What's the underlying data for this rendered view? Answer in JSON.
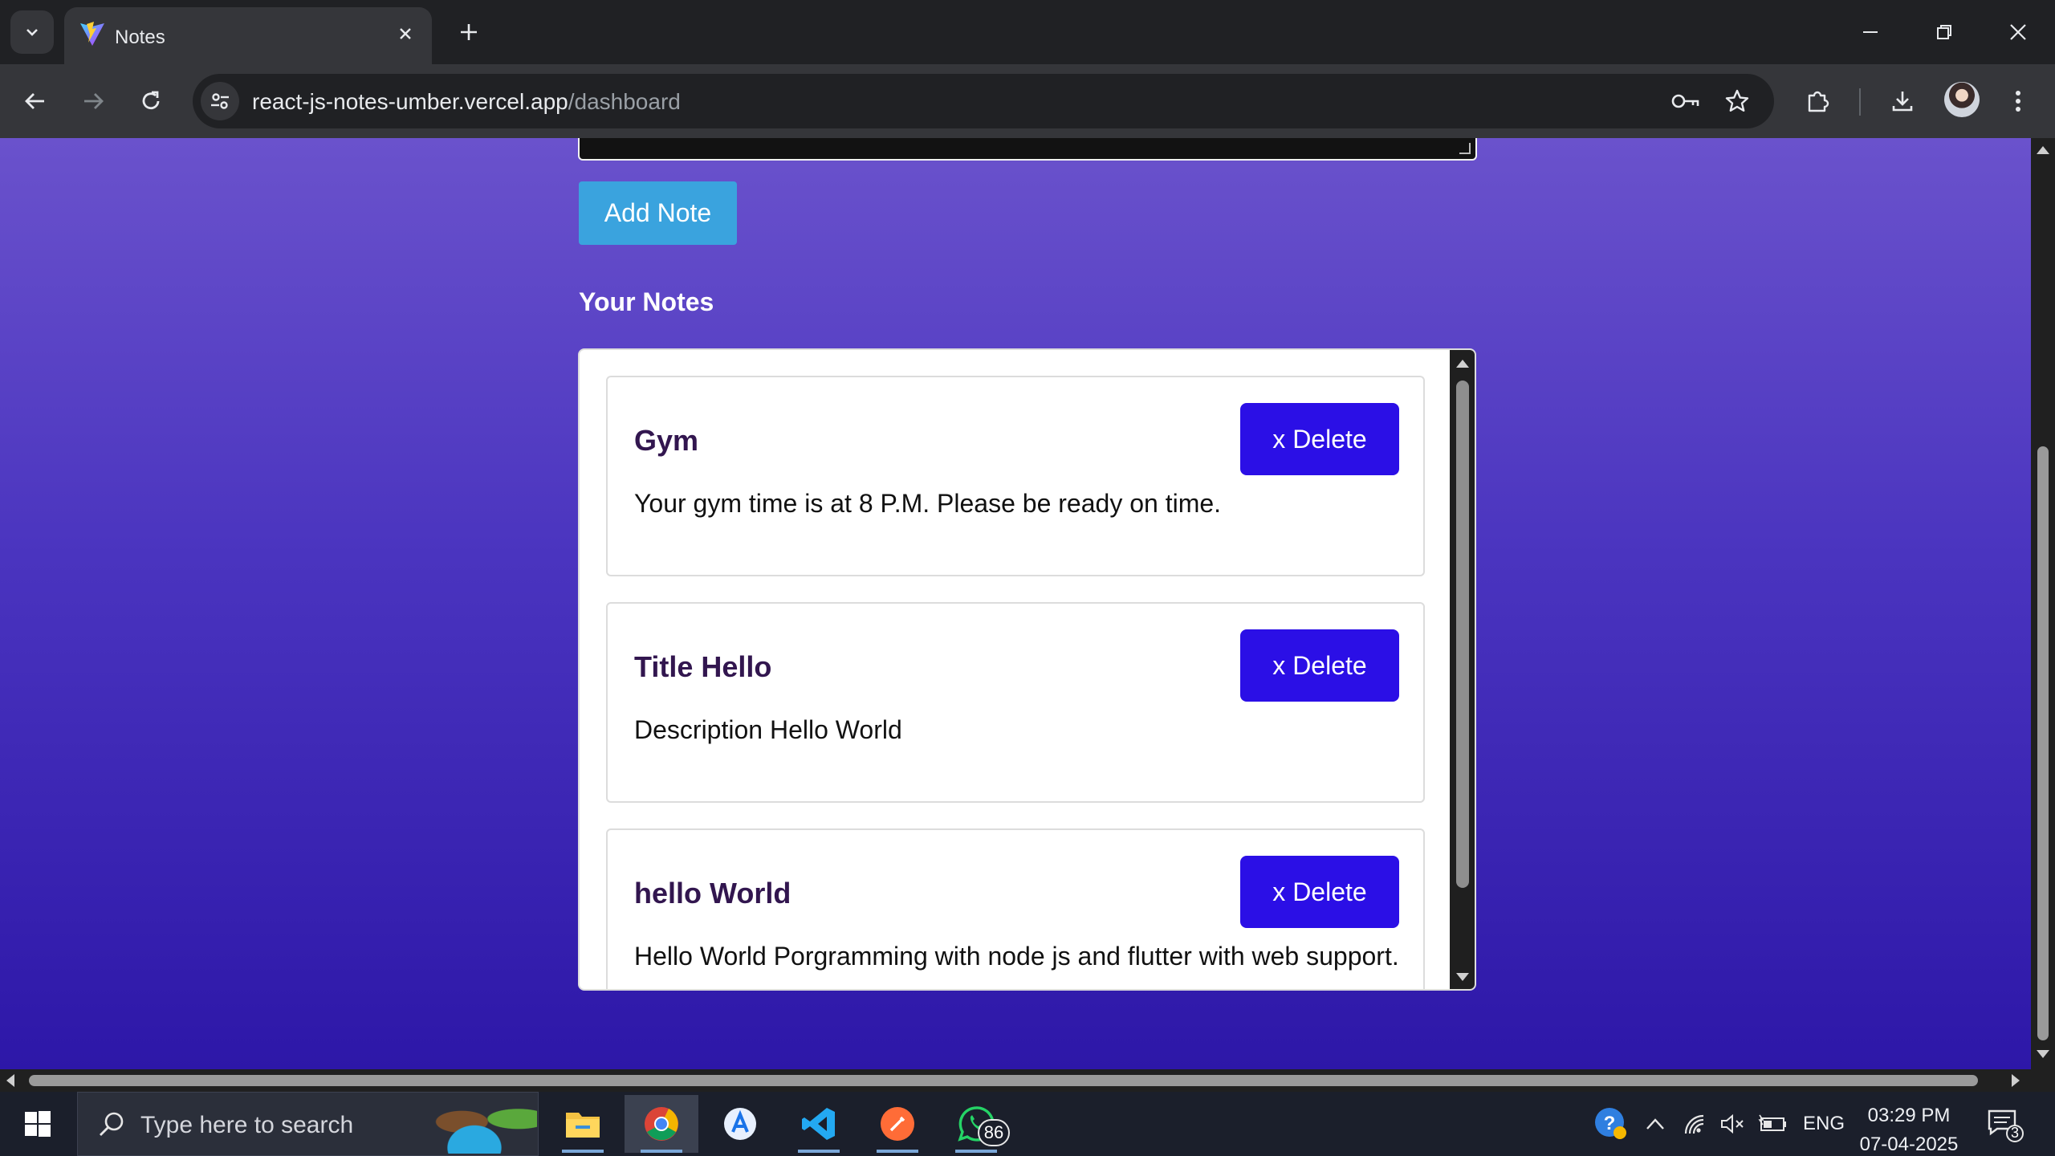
{
  "browser": {
    "tab_title": "Notes",
    "url_host": "react-js-notes-umber.vercel.app",
    "url_path": "/dashboard"
  },
  "page": {
    "add_button_label": "Add Note",
    "section_title": "Your Notes",
    "notes": [
      {
        "title": "Gym",
        "description": "Your gym time is at 8 P.M. Please be ready on time.",
        "delete_label": "x Delete"
      },
      {
        "title": "Title Hello",
        "description": "Description Hello World",
        "delete_label": "x Delete"
      },
      {
        "title": "hello World",
        "description": "Hello World Porgramming with node js and flutter with web support.",
        "delete_label": "x Delete"
      }
    ]
  },
  "taskbar": {
    "search_placeholder": "Type here to search",
    "whatsapp_badge": "86",
    "language": "ENG",
    "time": "03:29 PM",
    "date": "07-04-2025",
    "notification_count": "3"
  },
  "colors": {
    "page_gradient_top": "#6a52cc",
    "page_gradient_bottom": "#2d17a8",
    "add_button": "#3aa3de",
    "delete_button": "#2b0fe6",
    "note_title": "#32164f"
  }
}
